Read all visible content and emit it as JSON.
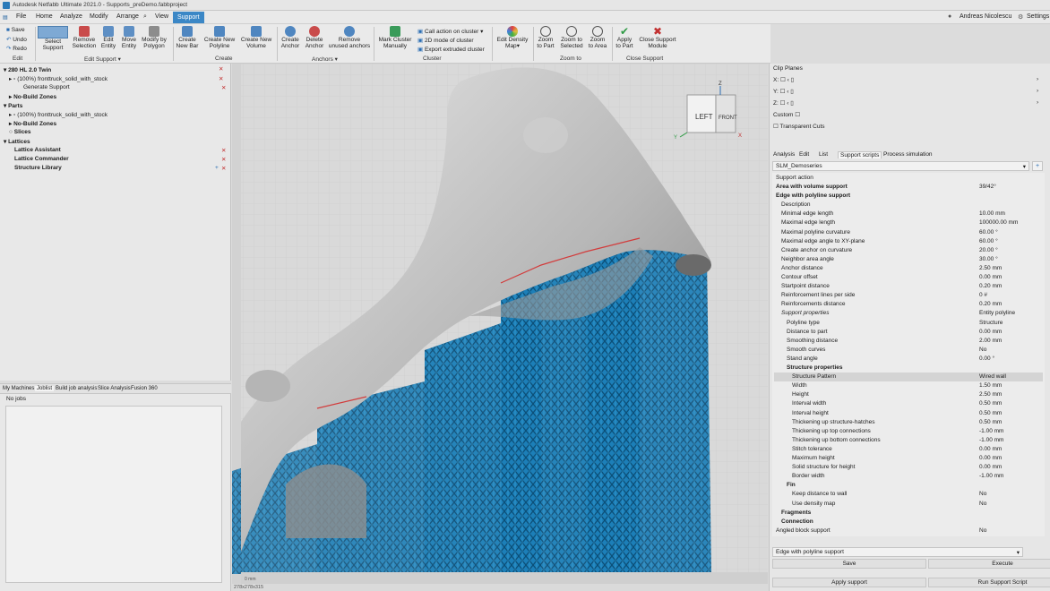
{
  "app": {
    "title": "Autodesk Netfabb Ultimate 2021.0 - Supports_preDemo.fabbproject",
    "user": "Andreas Nicolescu",
    "settings_label": "Settings"
  },
  "menu": {
    "file": "File",
    "home": "Home",
    "analyze": "Analyze",
    "modify": "Modify",
    "arrange": "Arrange",
    "view": "View",
    "support": "Support"
  },
  "ribbon": {
    "edit_small": [
      "Save",
      "Undo",
      "Redo"
    ],
    "edit_group": "Edit",
    "select_support": [
      "Select",
      "Support"
    ],
    "remove_selection": [
      "Remove",
      "Selection"
    ],
    "edit_entity": [
      "Edit",
      "Entity"
    ],
    "move_entity": [
      "Move",
      "Entity"
    ],
    "modify_polygon": [
      "Modify by",
      "Polygon"
    ],
    "edit_support_group": "Edit Support",
    "create_new_bar": [
      "Create",
      "New Bar"
    ],
    "create_new_polyline": [
      "Create New",
      "Polyline"
    ],
    "create_new_volume": [
      "Create New",
      "Volume"
    ],
    "create_group": "Create",
    "create_anchor": [
      "Create",
      "Anchor"
    ],
    "delete_anchor": [
      "Delete",
      "Anchor"
    ],
    "remove_unused_anchors": [
      "Remove",
      "unused anchors"
    ],
    "anchors_group": "Anchors",
    "mark_cluster": [
      "Mark Cluster",
      "Manually"
    ],
    "call_action_cluster": "Call action on cluster",
    "mode_2d_cluster": "2D mode of cluster",
    "export_extruded_cluster": "Export extruded cluster",
    "cluster_group": "Cluster",
    "edit_density_map": [
      "Edit Density",
      "Map"
    ],
    "zoom_part": [
      "Zoom",
      "to Part"
    ],
    "zoom_selected": [
      "Zoom to",
      "Selected"
    ],
    "zoom_area": [
      "Zoom",
      "to Area"
    ],
    "zoom_group": "Zoom to",
    "apply_part": [
      "Apply",
      "to Part"
    ],
    "close_support": [
      "Close Support",
      "Module"
    ],
    "close_group": "Close Support"
  },
  "tree": {
    "machine": "280 HL 2.0 Twin",
    "part_item": "(100%) fronttruck_solid_with_stock",
    "generate_support": "Generate Support",
    "no_build_zones": "No-Build Zones",
    "parts": "Parts",
    "part_item2": "(100%) fronttruck_solid_with_stock",
    "no_build_zones2": "No-Build Zones",
    "slices": "Slices",
    "lattices": "Lattices",
    "lattice_assistant": "Lattice Assistant",
    "lattice_commander": "Lattice Commander",
    "structure_library": "Structure Library"
  },
  "bottom_tabs": [
    "My Machines",
    "Joblist",
    "Build job analysis",
    "Slice Analysis",
    "Fusion 360"
  ],
  "jobs": {
    "empty_text": "No jobs"
  },
  "viewcube": {
    "left": "LEFT",
    "front": "FRONT",
    "axis_x": "X",
    "axis_y": "Y",
    "axis_z": "Z"
  },
  "status": {
    "coords": "278x278x315",
    "ruler_start": "0 mm"
  },
  "clip_planes": {
    "title": "Clip Planes",
    "x": "X:",
    "y": "Y:",
    "z": "Z:",
    "custom": "Custom",
    "transparent_cuts": "Transparent Cuts"
  },
  "panel_tabs": [
    "Analysis",
    "Edit",
    "List",
    "Support scripts",
    "Process simulation"
  ],
  "script_select": "SLM_Demoseries",
  "properties": {
    "header": "Support action",
    "rows": [
      {
        "label": "Area with volume support",
        "value": "39/42°",
        "indent": 1,
        "bold": true
      },
      {
        "label": "Edge with polyline support",
        "value": "",
        "indent": 1,
        "bold": true
      },
      {
        "label": "Description",
        "value": "",
        "indent": 2,
        "bold": false
      },
      {
        "label": "Minimal edge length",
        "value": "10.00 mm",
        "indent": 2,
        "bold": false
      },
      {
        "label": "Maximal edge length",
        "value": "100000.00 mm",
        "indent": 2,
        "bold": false
      },
      {
        "label": "Maximal polyline curvature",
        "value": "60.00 °",
        "indent": 2,
        "bold": false
      },
      {
        "label": "Maximal edge angle to XY-plane",
        "value": "60.00 °",
        "indent": 2,
        "bold": false
      },
      {
        "label": "Create anchor on curvature",
        "value": "20.00 °",
        "indent": 2,
        "bold": false
      },
      {
        "label": "Neighbor area angle",
        "value": "30.00 °",
        "indent": 2,
        "bold": false
      },
      {
        "label": "Anchor distance",
        "value": "2.50 mm",
        "indent": 2,
        "bold": false
      },
      {
        "label": "Contour offset",
        "value": "0.00 mm",
        "indent": 2,
        "bold": false
      },
      {
        "label": "Startpoint distance",
        "value": "0.20 mm",
        "indent": 2,
        "bold": false
      },
      {
        "label": "Reinforcement lines per side",
        "value": "0 #",
        "indent": 2,
        "bold": false
      },
      {
        "label": "Reinforcements distance",
        "value": "0.20 mm",
        "indent": 2,
        "bold": false
      },
      {
        "label": "Support properties",
        "value": "Entity polyline",
        "indent": 2,
        "bold": false,
        "italic": true
      },
      {
        "label": "Polyline type",
        "value": "Structure",
        "indent": 3,
        "bold": false
      },
      {
        "label": "Distance to part",
        "value": "0.00 mm",
        "indent": 3,
        "bold": false
      },
      {
        "label": "Smoothing distance",
        "value": "2.00 mm",
        "indent": 3,
        "bold": false
      },
      {
        "label": "Smooth curves",
        "value": "No",
        "indent": 3,
        "bold": false
      },
      {
        "label": "Stand angle",
        "value": "0.00 °",
        "indent": 3,
        "bold": false
      },
      {
        "label": "Structure properties",
        "value": "",
        "indent": 3,
        "bold": true
      },
      {
        "label": "Structure Pattern",
        "value": "Wired wall",
        "indent": 4,
        "bold": false,
        "selected": true
      },
      {
        "label": "Width",
        "value": "1.50 mm",
        "indent": 4,
        "bold": false
      },
      {
        "label": "Height",
        "value": "2.50 mm",
        "indent": 4,
        "bold": false
      },
      {
        "label": "Interval width",
        "value": "0.50 mm",
        "indent": 4,
        "bold": false
      },
      {
        "label": "Interval height",
        "value": "0.50 mm",
        "indent": 4,
        "bold": false
      },
      {
        "label": "Thickening up structure-hatches",
        "value": "0.50 mm",
        "indent": 4,
        "bold": false
      },
      {
        "label": "Thickening up top connections",
        "value": "-1.00 mm",
        "indent": 4,
        "bold": false
      },
      {
        "label": "Thickening up bottom connections",
        "value": "-1.00 mm",
        "indent": 4,
        "bold": false
      },
      {
        "label": "Stitch tolerance",
        "value": "0.00 mm",
        "indent": 4,
        "bold": false
      },
      {
        "label": "Maximum height",
        "value": "0.00 mm",
        "indent": 4,
        "bold": false
      },
      {
        "label": "Solid structure for height",
        "value": "0.00 mm",
        "indent": 4,
        "bold": false
      },
      {
        "label": "Border width",
        "value": "-1.00 mm",
        "indent": 4,
        "bold": false
      },
      {
        "label": "Fin",
        "value": "",
        "indent": 3,
        "bold": true
      },
      {
        "label": "Keep distance to wall",
        "value": "No",
        "indent": 4,
        "bold": false
      },
      {
        "label": "Use density map",
        "value": "No",
        "indent": 4,
        "bold": false
      },
      {
        "label": "Fragments",
        "value": "",
        "indent": 2,
        "bold": true
      },
      {
        "label": "Connection",
        "value": "",
        "indent": 2,
        "bold": true
      },
      {
        "label": "Angled block support",
        "value": "No",
        "indent": 1,
        "bold": false
      }
    ]
  },
  "bottom_select": "Edge with polyline support",
  "actions": {
    "save": "Save",
    "execute": "Execute",
    "apply_support": "Apply support",
    "run_script": "Run Support Script"
  }
}
